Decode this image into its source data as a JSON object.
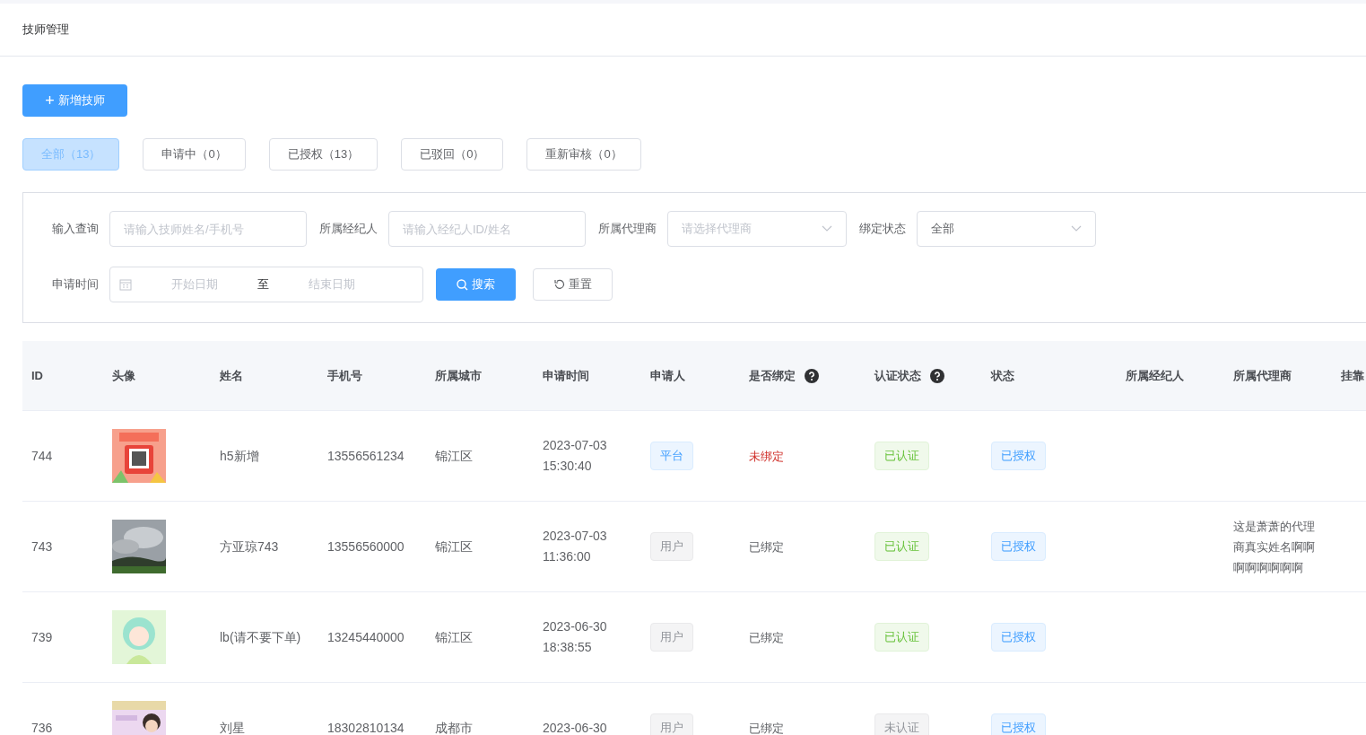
{
  "page_title": "技师管理",
  "add_button": {
    "icon": "+",
    "label": "新增技师"
  },
  "tabs": [
    {
      "label": "全部（13）",
      "selected": true
    },
    {
      "label": "申请中（0）",
      "selected": false
    },
    {
      "label": "已授权（13）",
      "selected": false
    },
    {
      "label": "已驳回（0）",
      "selected": false
    },
    {
      "label": "重新审核（0）",
      "selected": false
    }
  ],
  "filters": {
    "query": {
      "label": "输入查询",
      "placeholder": "请输入技师姓名/手机号"
    },
    "broker": {
      "label": "所属经纪人",
      "placeholder": "请输入经纪人ID/姓名"
    },
    "agent": {
      "label": "所属代理商",
      "placeholder": "请选择代理商"
    },
    "binding": {
      "label": "绑定状态",
      "value": "全部"
    },
    "date": {
      "label": "申请时间",
      "start_placeholder": "开始日期",
      "separator": "至",
      "end_placeholder": "结束日期"
    },
    "search_button": "搜索",
    "reset_button": "重置"
  },
  "table": {
    "columns": [
      {
        "label": "ID",
        "help": false
      },
      {
        "label": "头像",
        "help": false
      },
      {
        "label": "姓名",
        "help": false
      },
      {
        "label": "手机号",
        "help": false
      },
      {
        "label": "所属城市",
        "help": false
      },
      {
        "label": "申请时间",
        "help": false
      },
      {
        "label": "申请人",
        "help": false
      },
      {
        "label": "是否绑定",
        "help": true
      },
      {
        "label": "认证状态",
        "help": true
      },
      {
        "label": "状态",
        "help": false
      },
      {
        "label": "所属经纪人",
        "help": false
      },
      {
        "label": "所属代理商",
        "help": false
      },
      {
        "label": "挂靠"
      }
    ],
    "rows": [
      {
        "id": "744",
        "avatar": {
          "kind": "picture"
        },
        "name": "h5新增",
        "phone": "13556561234",
        "city": "锦江区",
        "time": [
          "2023-07-03",
          "15:30:40"
        ],
        "applicant": {
          "kind": "platform",
          "label": "平台"
        },
        "binding": {
          "bound": false,
          "label": "未绑定"
        },
        "certification": {
          "certified": true,
          "label": "已认证"
        },
        "status": "已授权"
      },
      {
        "id": "743",
        "avatar": {
          "kind": "picture"
        },
        "name": "方亚琼743",
        "phone": "13556560000",
        "city": "锦江区",
        "time": [
          "2023-07-03",
          "11:36:00"
        ],
        "applicant": {
          "kind": "user",
          "label": "用户"
        },
        "binding": {
          "bound": true,
          "label": "已绑定"
        },
        "certification": {
          "certified": true,
          "label": "已认证"
        },
        "status": "已授权",
        "agent": "这是萧萧的代理商真实姓名啊啊啊啊啊啊啊啊"
      },
      {
        "id": "739",
        "avatar": {
          "kind": "picture"
        },
        "name": "lb(请不要下单)",
        "phone": "13245440000",
        "city": "锦江区",
        "time": [
          "2023-06-30",
          "18:38:55"
        ],
        "applicant": {
          "kind": "user",
          "label": "用户"
        },
        "binding": {
          "bound": true,
          "label": "已绑定"
        },
        "certification": {
          "certified": true,
          "label": "已认证"
        },
        "status": "已授权"
      },
      {
        "id": "736",
        "avatar": {
          "kind": "picture"
        },
        "name": "刘星",
        "phone": "18302810134",
        "city": "成都市",
        "time": [
          "2023-06-30"
        ],
        "applicant": {
          "kind": "user",
          "label": "用户"
        },
        "binding": {
          "bound": true,
          "label": "已绑定"
        },
        "certification": {
          "certified": false,
          "label": "未认证"
        },
        "status": "已授权"
      }
    ]
  }
}
